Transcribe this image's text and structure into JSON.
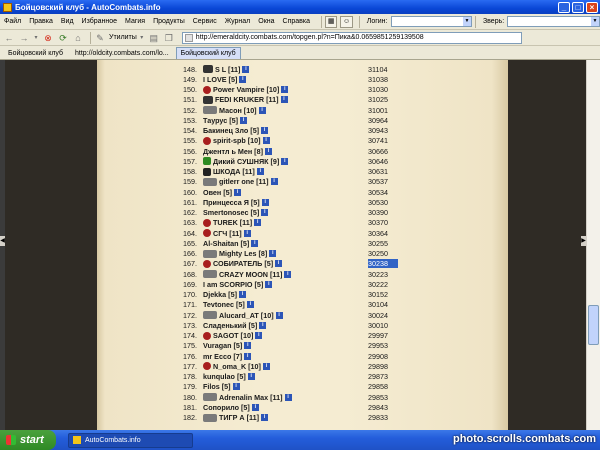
{
  "window": {
    "title": "Бойцовский клуб - AutoCombats.info",
    "buttons": [
      "_",
      "□",
      "×"
    ]
  },
  "menu": {
    "items": [
      "Файл",
      "Правка",
      "Вид",
      "Избранное",
      "Магия",
      "Продукты",
      "Сервис",
      "Журнал",
      "Окна",
      "Справка"
    ],
    "login_label": "Логин:",
    "beast_label": "Зверь:"
  },
  "toolbar": {
    "utilities_label": "Утилиты",
    "address": "http://emeraldcity.combats.com/topgen.pl?n=Пика&0.0659851259139508"
  },
  "tabs": [
    {
      "label": "Бойцовский клуб",
      "active": false
    },
    {
      "label": "http://oldcity.combats.com/lo...",
      "active": false
    },
    {
      "label": "Бойцовский клуб",
      "active": true
    }
  ],
  "ranking": [
    {
      "num": "148.",
      "nick": "S L [11]",
      "score": "31104",
      "clan": "dark"
    },
    {
      "num": "149.",
      "nick": "I LOVE [5]",
      "score": "31038",
      "clan": ""
    },
    {
      "num": "150.",
      "nick": "Power Vampire [10]",
      "score": "31030",
      "clan": "red"
    },
    {
      "num": "151.",
      "nick": "FEDI KRUKER [11]",
      "score": "31025",
      "clan": "dark"
    },
    {
      "num": "152.",
      "nick": "Масон [10]",
      "score": "31001",
      "clan": "wing"
    },
    {
      "num": "153.",
      "nick": "Таурус [5]",
      "score": "30964",
      "clan": ""
    },
    {
      "num": "154.",
      "nick": "Бакинец Зло [5]",
      "score": "30943",
      "clan": ""
    },
    {
      "num": "155.",
      "nick": "spirit-spb [10]",
      "score": "30741",
      "clan": "red"
    },
    {
      "num": "156.",
      "nick": "Джентл ь Мен [8]",
      "score": "30666",
      "clan": ""
    },
    {
      "num": "157.",
      "nick": "Дикий СУШНЯК [9]",
      "score": "30646",
      "clan": "green"
    },
    {
      "num": "158.",
      "nick": "ШКОДА [11]",
      "score": "30631",
      "clan": "black"
    },
    {
      "num": "159.",
      "nick": "gitlerr one [11]",
      "score": "30537",
      "clan": "wing"
    },
    {
      "num": "160.",
      "nick": "Овен [5]",
      "score": "30534",
      "clan": ""
    },
    {
      "num": "161.",
      "nick": "Принцесса Я [5]",
      "score": "30530",
      "clan": ""
    },
    {
      "num": "162.",
      "nick": "Smertonosec [5]",
      "score": "30390",
      "clan": ""
    },
    {
      "num": "163.",
      "nick": "TUREK [11]",
      "score": "30370",
      "clan": "red"
    },
    {
      "num": "164.",
      "nick": "СГЧ [11]",
      "score": "30364",
      "clan": "red"
    },
    {
      "num": "165.",
      "nick": "Al-Shaitan [5]",
      "score": "30255",
      "clan": ""
    },
    {
      "num": "166.",
      "nick": "Mighty Les [8]",
      "score": "30250",
      "clan": "wing"
    },
    {
      "num": "167.",
      "nick": "СОБИРАТЕЛЬ [5]",
      "score": "30238",
      "clan": "red",
      "highlight": true
    },
    {
      "num": "168.",
      "nick": "CRAZY MOON [11]",
      "score": "30223",
      "clan": "wing"
    },
    {
      "num": "169.",
      "nick": "I am SCORPIO [5]",
      "score": "30222",
      "clan": ""
    },
    {
      "num": "170.",
      "nick": "Djekka [5]",
      "score": "30152",
      "clan": ""
    },
    {
      "num": "171.",
      "nick": "Tevtonec [5]",
      "score": "30104",
      "clan": ""
    },
    {
      "num": "172.",
      "nick": "Alucard_AT [10]",
      "score": "30024",
      "clan": "wing"
    },
    {
      "num": "173.",
      "nick": "Сладенький [5]",
      "score": "30010",
      "clan": ""
    },
    {
      "num": "174.",
      "nick": "SAGOT [10]",
      "score": "29997",
      "clan": "red"
    },
    {
      "num": "175.",
      "nick": "Vuragan [5]",
      "score": "29953",
      "clan": ""
    },
    {
      "num": "176.",
      "nick": "mr Ecco [7]",
      "score": "29908",
      "clan": ""
    },
    {
      "num": "177.",
      "nick": "N_oma_K [10]",
      "score": "29898",
      "clan": "red"
    },
    {
      "num": "178.",
      "nick": "kunqulao [5]",
      "score": "29873",
      "clan": ""
    },
    {
      "num": "179.",
      "nick": "Filos [5]",
      "score": "29858",
      "clan": ""
    },
    {
      "num": "180.",
      "nick": "Adrenalin Max [11]",
      "score": "29853",
      "clan": "wing"
    },
    {
      "num": "181.",
      "nick": "Сопорило [5]",
      "score": "29843",
      "clan": ""
    },
    {
      "num": "182.",
      "nick": "ТИГР А [11]",
      "score": "29833",
      "clan": "wing"
    }
  ],
  "taskbar": {
    "start_label": "start",
    "task_label": "AutoCombats.info",
    "watermark": "photo.scrolls.combats.com"
  }
}
